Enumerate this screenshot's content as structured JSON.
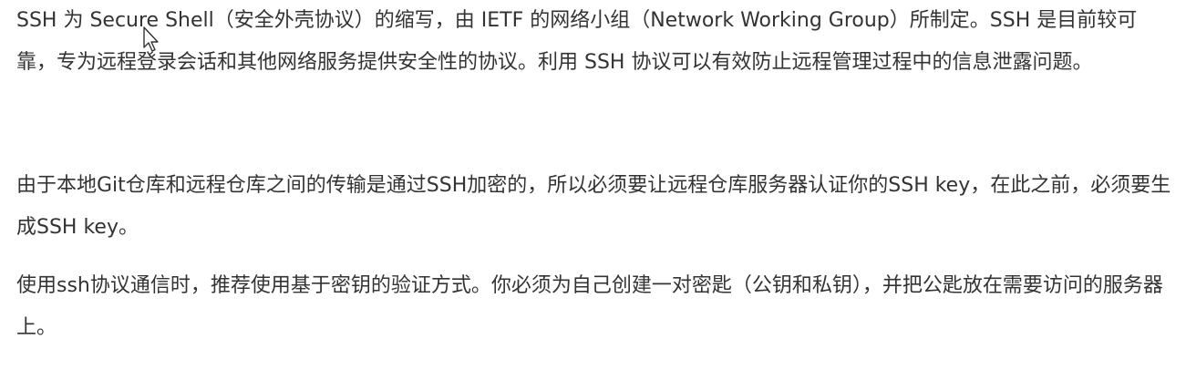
{
  "document": {
    "paragraphs": [
      "SSH 为 Secure Shell（安全外壳协议）的缩写，由 IETF 的网络小组（Network Working Group）所制定。SSH 是目前较可靠，专为远程登录会话和其他网络服务提供安全性的协议。利用 SSH 协议可以有效防止远程管理过程中的信息泄露问题。",
      "由于本地Git仓库和远程仓库之间的传输是通过SSH加密的，所以必须要让远程仓库服务器认证你的SSH key，在此之前，必须要生成SSH key。",
      "使用ssh协议通信时，推荐使用基于密钥的验证方式。你必须为自己创建一对密匙（公钥和私钥），并把公匙放在需要访问的服务器上。"
    ]
  },
  "cursor": {
    "icon": "mouse-pointer-icon"
  },
  "colors": {
    "text": "#333333",
    "background": "#ffffff"
  }
}
